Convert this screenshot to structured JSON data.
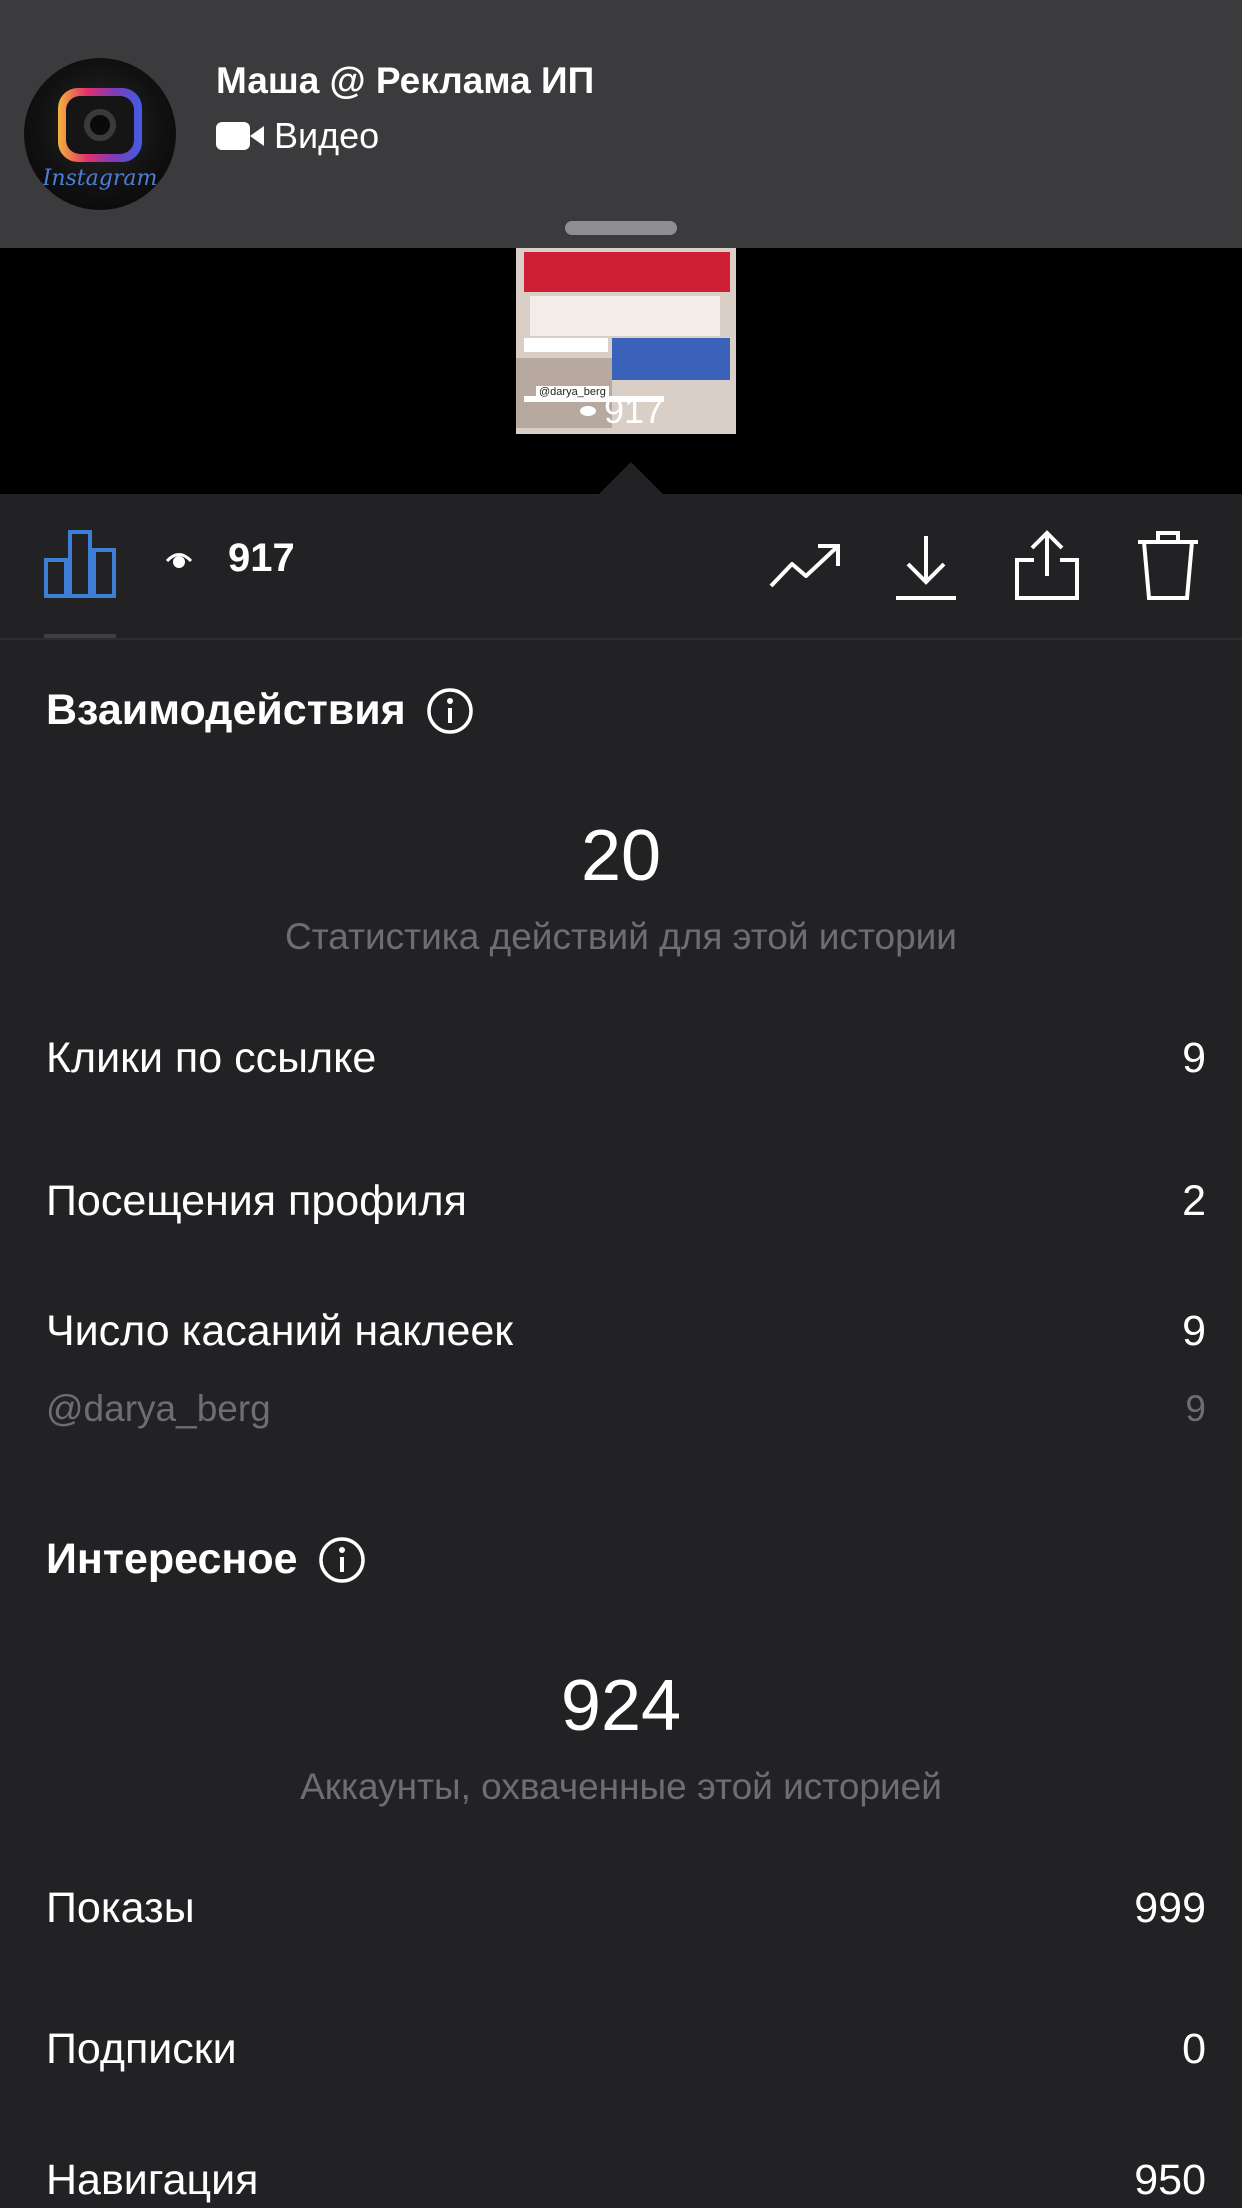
{
  "header": {
    "avatar_text": "Instagram",
    "chat_name": "Маша @ Реклама ИП",
    "message_type": "Видео",
    "icon": "video-camera-icon"
  },
  "preview": {
    "sticker_handle": "@darya_berg",
    "views": "917"
  },
  "toolbar": {
    "views": "917",
    "icons": [
      "bar-chart-icon",
      "eye-icon",
      "trending-icon",
      "download-icon",
      "share-icon",
      "trash-icon"
    ],
    "accent_color": "#3d7ed6"
  },
  "interactions": {
    "title": "Взаимодействия",
    "total": "20",
    "caption": "Статистика действий для этой истории",
    "rows": [
      {
        "label": "Клики по ссылке",
        "value": "9"
      },
      {
        "label": "Посещения профиля",
        "value": "2"
      },
      {
        "label": "Число касаний наклеек",
        "value": "9"
      }
    ],
    "sub_row": {
      "label": "@darya_berg",
      "value": "9"
    }
  },
  "discovery": {
    "title": "Интересное",
    "total": "924",
    "caption": "Аккаунты, охваченные этой историей",
    "rows": [
      {
        "label": "Показы",
        "value": "999"
      },
      {
        "label": "Подписки",
        "value": "0"
      },
      {
        "label": "Навигация",
        "value": "950"
      }
    ]
  }
}
